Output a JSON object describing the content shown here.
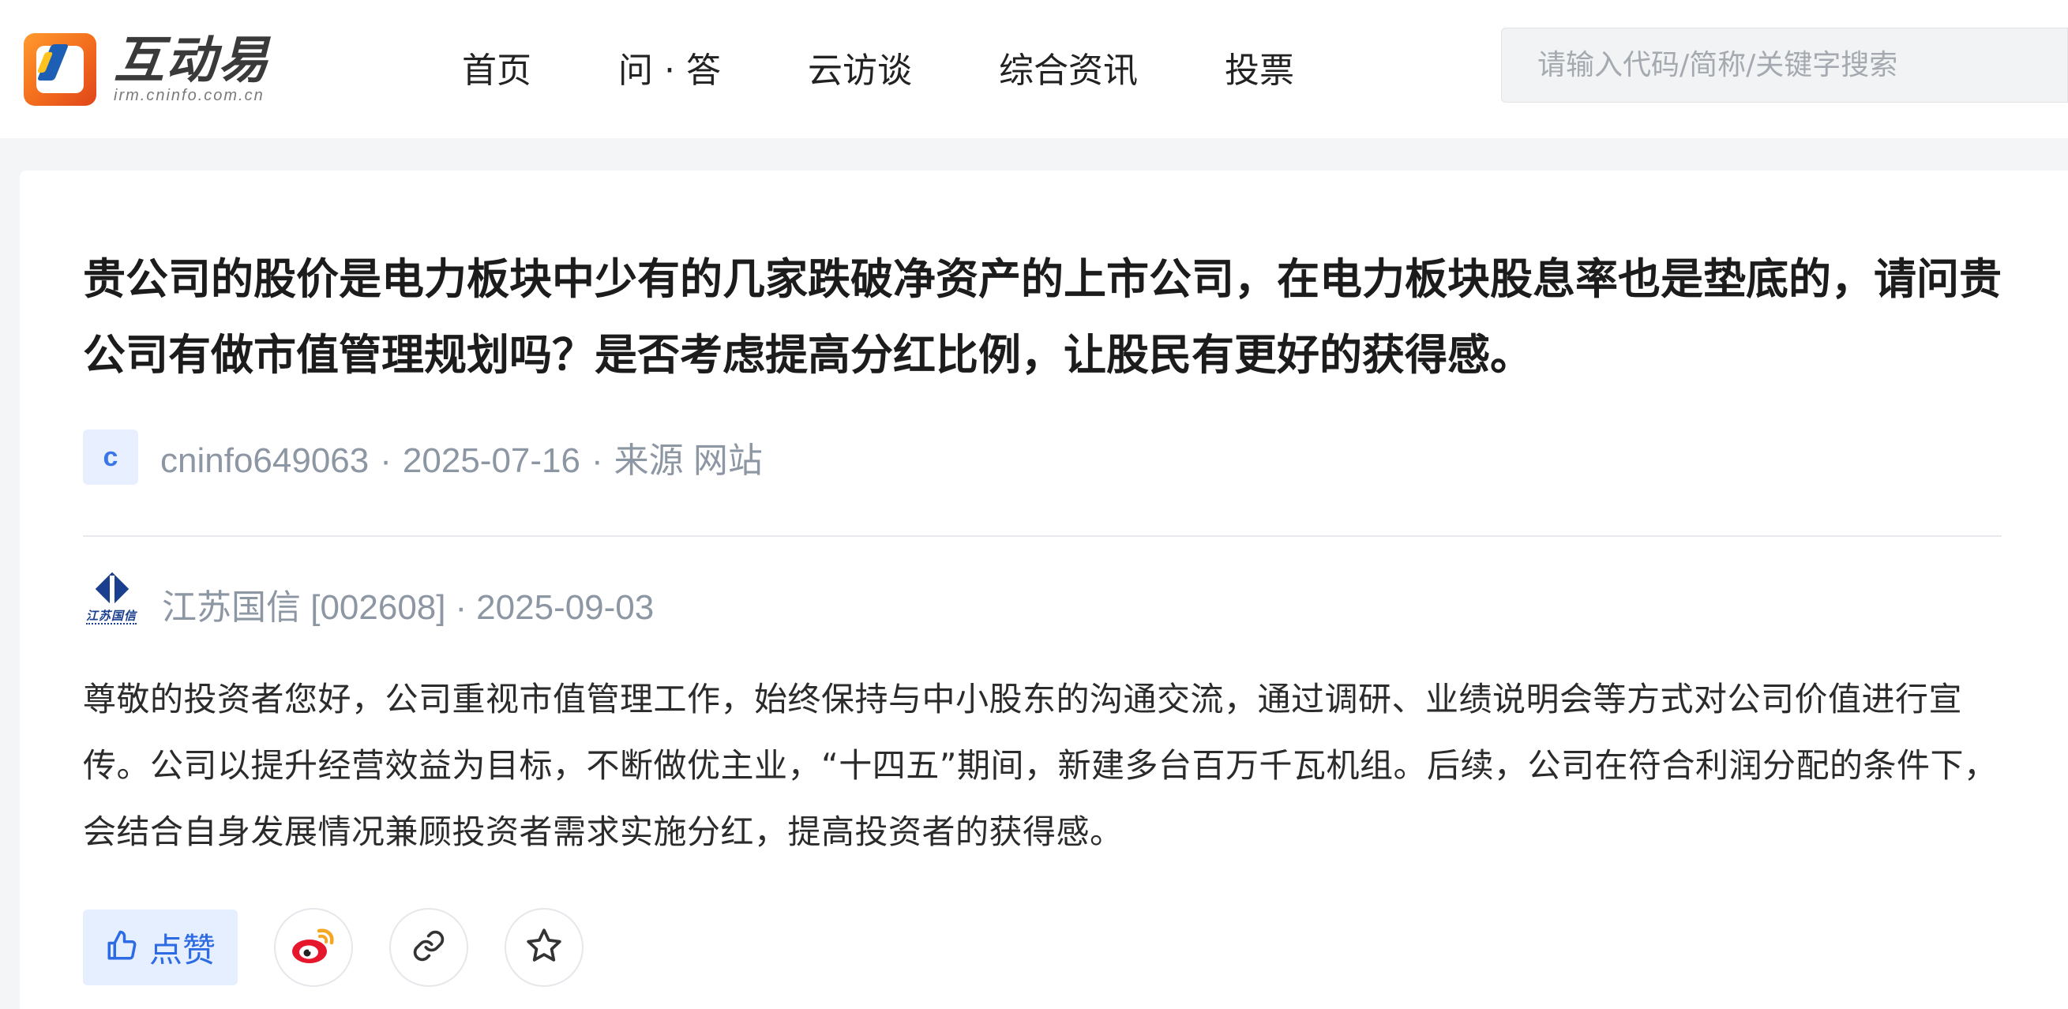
{
  "header": {
    "logo": {
      "title": "互动易",
      "subtitle": "irm.cninfo.com.cn"
    },
    "nav": {
      "items": [
        {
          "label": "首页"
        },
        {
          "label": "问 · 答"
        },
        {
          "label": "云访谈"
        },
        {
          "label": "综合资讯"
        },
        {
          "label": "投票"
        }
      ]
    },
    "search": {
      "placeholder": "请输入代码/简称/关键字搜索",
      "value": ""
    }
  },
  "question": {
    "text": "贵公司的股价是电力板块中少有的几家跌破净资产的上市公司，在电力板块股息率也是垫底的，请问贵公司有做市值管理规划吗？是否考虑提高分红比例，让股民有更好的获得感。",
    "asker": {
      "avatar_letter": "c",
      "username": "cninfo649063",
      "date": "2025-07-16",
      "source": "来源 网站",
      "separator": "·"
    }
  },
  "answer": {
    "company_logo_text": "江苏国信",
    "company": "江苏国信 [002608]",
    "date": "2025-09-03",
    "separator": "·",
    "text": "尊敬的投资者您好，公司重视市值管理工作，始终保持与中小股东的沟通交流，通过调研、业绩说明会等方式对公司价值进行宣传。公司以提升经营效益为目标，不断做优主业，“十四五”期间，新建多台百万千瓦机组。后续，公司在符合利润分配的条件下，会结合自身发展情况兼顾投资者需求实施分红，提高投资者的获得感。"
  },
  "actions": {
    "like_label": "点赞",
    "icons": {
      "like": "thumbs-up-icon",
      "weibo": "weibo-icon",
      "link": "link-icon",
      "favorite": "star-icon"
    }
  },
  "colors": {
    "accent": "#2d6be4",
    "meta_text": "#8d96a3",
    "weibo_red": "#e6162d",
    "weibo_orange": "#f5a623"
  }
}
